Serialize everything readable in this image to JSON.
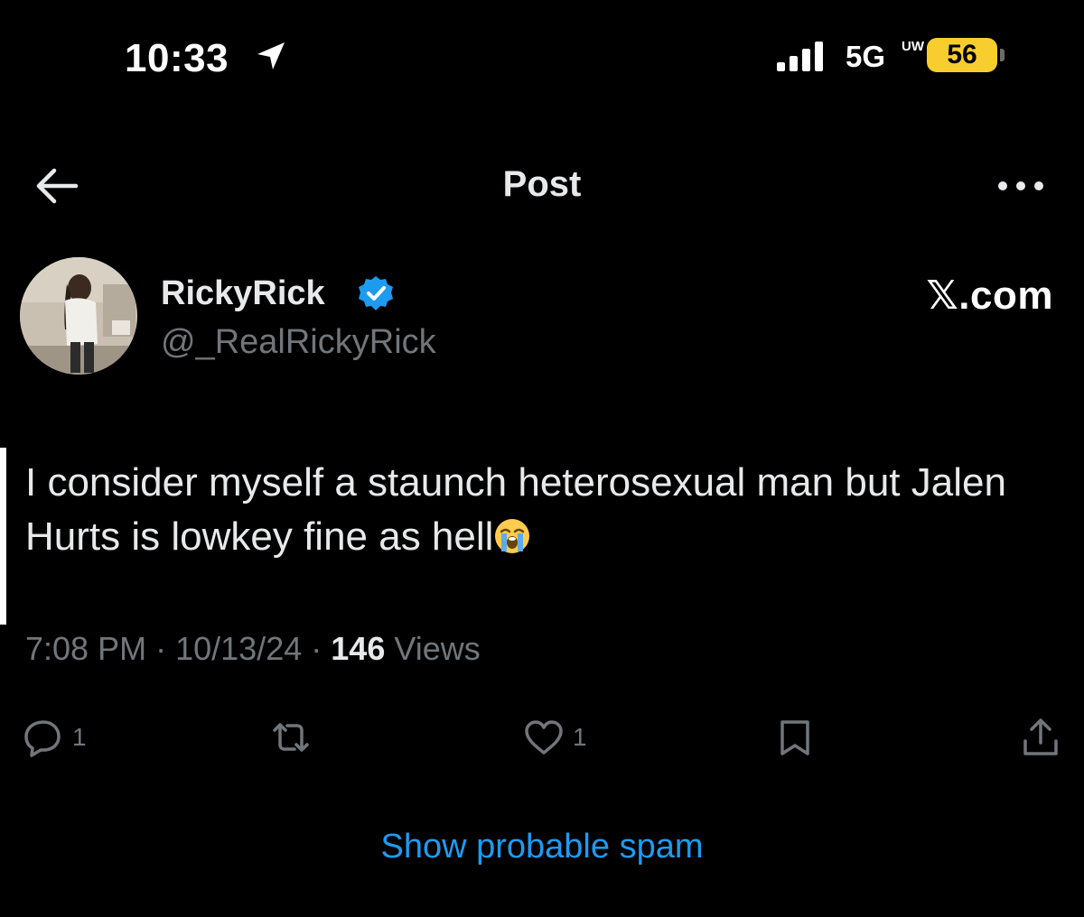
{
  "status_bar": {
    "time": "10:33",
    "network": "5G",
    "network_sub": "UW",
    "battery": "56",
    "battery_color": "#f7ce2e"
  },
  "nav": {
    "title": "Post",
    "back_icon": "arrow-left-icon",
    "more_icon": "more-horizontal-icon"
  },
  "author": {
    "name": "RickyRick",
    "handle": "@_RealRickyRick",
    "verified": true,
    "verified_color": "#1d9bf0"
  },
  "watermark": "𝕏.com",
  "post": {
    "text": "I consider myself a staunch heterosexual man but Jalen Hurts is lowkey fine as hell",
    "emoji": "loudly-crying-face-icon"
  },
  "meta": {
    "time": "7:08 PM",
    "date": "10/13/24",
    "views_count": "146",
    "views_label": "Views",
    "separator": "·"
  },
  "actions": {
    "reply_count": "1",
    "like_count": "1"
  },
  "spam_link": "Show probable spam",
  "colors": {
    "background": "#000000",
    "text": "#e7e9ea",
    "muted": "#71767b",
    "accent": "#1d9bf0"
  }
}
